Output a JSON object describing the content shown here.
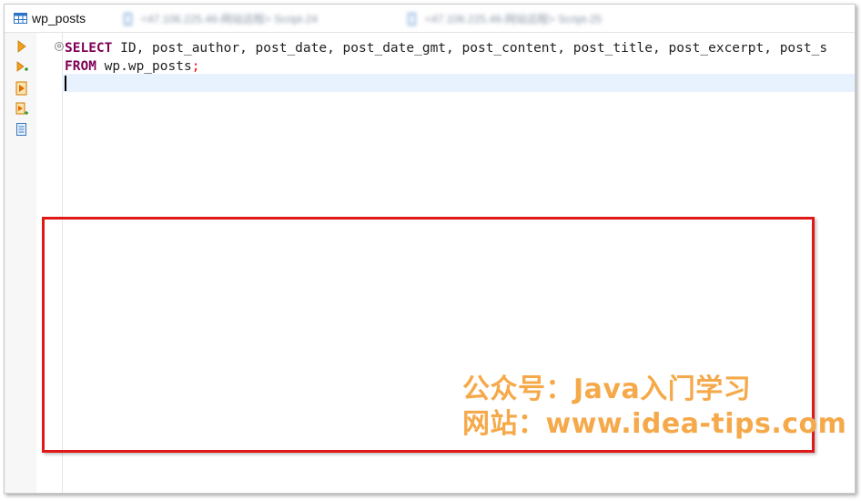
{
  "tabs": [
    {
      "label": "wp_posts",
      "icon": "table-icon",
      "active": true
    },
    {
      "label": "<47.106.225.46-网站远程> Script-24",
      "icon": "script-icon",
      "active": false
    },
    {
      "label": "<47.106.225.46-网站远程> Script-25",
      "icon": "script-icon",
      "active": false
    }
  ],
  "toolbar": [
    {
      "name": "execute-statement-icon"
    },
    {
      "name": "execute-in-new-tab-icon"
    },
    {
      "name": "execute-script-icon"
    },
    {
      "name": "execute-script-new-tab-icon"
    },
    {
      "name": "explain-plan-icon"
    }
  ],
  "editor": {
    "line1": {
      "kw": "SELECT",
      "rest": " ID, post_author, post_date, post_date_gmt, post_content, post_title, post_excerpt, post_s"
    },
    "line2": {
      "kw": "FROM",
      "rest": " wp.wp_posts",
      "semi": ";"
    },
    "fold_symbol": "⊖"
  },
  "watermark": {
    "line1": "公众号：Java入门学习",
    "line2": "网站：www.idea-tips.com"
  },
  "colors": {
    "keyword": "#7f0055",
    "highlight_box": "#e01818",
    "watermark": "#f5a94a",
    "current_line": "#e8f2fe"
  }
}
